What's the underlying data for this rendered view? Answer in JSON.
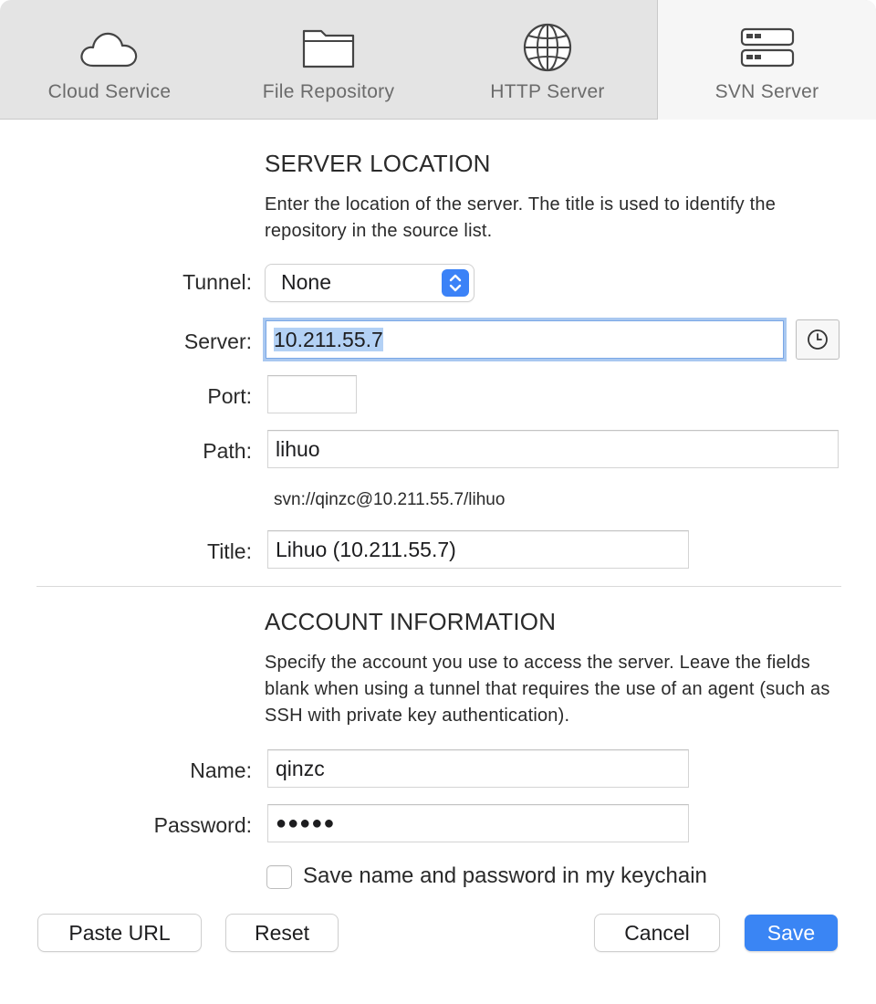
{
  "tabs": [
    {
      "label": "Cloud Service",
      "icon": "cloud-icon"
    },
    {
      "label": "File Repository",
      "icon": "folder-icon"
    },
    {
      "label": "HTTP Server",
      "icon": "globe-icon"
    },
    {
      "label": "SVN Server",
      "icon": "server-icon",
      "active": true
    }
  ],
  "server_location": {
    "title": "SERVER LOCATION",
    "description": "Enter the location of the server. The title is used to identify the repository in the source list.",
    "tunnel_label": "Tunnel:",
    "tunnel_value": "None",
    "server_label": "Server:",
    "server_value": "10.211.55.7",
    "port_label": "Port:",
    "port_value": "",
    "path_label": "Path:",
    "path_value": "lihuo",
    "url_preview": "svn://qinzc@10.211.55.7/lihuo",
    "title_label": "Title:",
    "title_value": "Lihuo (10.211.55.7)"
  },
  "account": {
    "title": "ACCOUNT INFORMATION",
    "description": "Specify the account you use to access the server. Leave the fields blank when using a tunnel that requires the use of an agent (such as SSH with private key authentication).",
    "name_label": "Name:",
    "name_value": "qinzc",
    "password_label": "Password:",
    "password_value": "●●●●●",
    "keychain_label": "Save name and password in my keychain",
    "keychain_checked": false
  },
  "buttons": {
    "paste_url": "Paste URL",
    "reset": "Reset",
    "cancel": "Cancel",
    "save": "Save"
  },
  "colors": {
    "accent": "#3a85f4",
    "focus_ring": "#a9c8f0",
    "selection": "#b3d1f5"
  }
}
